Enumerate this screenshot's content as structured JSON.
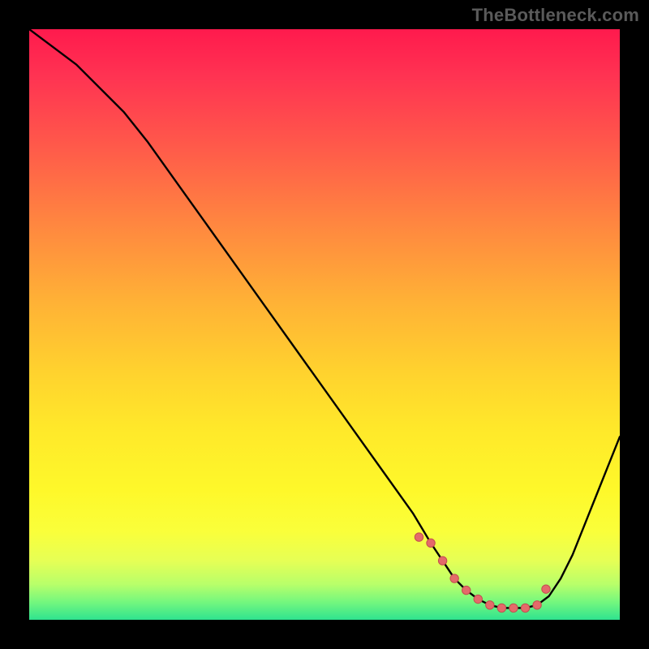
{
  "watermark": "TheBottleneck.com",
  "colors": {
    "curve_stroke": "#000000",
    "marker_fill": "#e46a6a",
    "marker_stroke": "#c24f4f"
  },
  "chart_data": {
    "type": "line",
    "title": "",
    "xlabel": "",
    "ylabel": "",
    "xlim": [
      0,
      100
    ],
    "ylim": [
      0,
      100
    ],
    "axes_visible": false,
    "grid": false,
    "background": "heat-gradient",
    "series": [
      {
        "name": "bottleneck-curve",
        "x": [
          0,
          4,
          8,
          12,
          16,
          20,
          25,
          30,
          35,
          40,
          45,
          50,
          55,
          60,
          65,
          68,
          70,
          72,
          74,
          76,
          78,
          80,
          82,
          84,
          86,
          88,
          90,
          92,
          94,
          96,
          98,
          100
        ],
        "y": [
          100,
          97,
          94,
          90,
          86,
          81,
          74,
          67,
          60,
          53,
          46,
          39,
          32,
          25,
          18,
          13,
          10,
          7,
          5,
          3.5,
          2.5,
          2,
          2,
          2,
          2.5,
          4,
          7,
          11,
          16,
          21,
          26,
          31
        ]
      }
    ],
    "markers": {
      "name": "sweet-spot",
      "x": [
        66,
        68,
        70,
        72,
        74,
        76,
        78,
        80,
        82,
        84,
        86,
        87.5
      ],
      "y": [
        14,
        13,
        10,
        7,
        5,
        3.5,
        2.5,
        2,
        2,
        2,
        2.5,
        5.2
      ]
    }
  }
}
